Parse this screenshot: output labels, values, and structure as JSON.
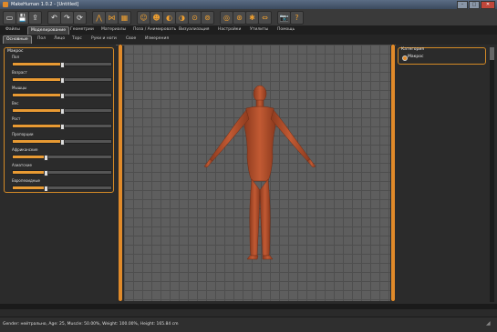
{
  "window": {
    "title": "MakeHuman 1.0.2 - [Untitled]",
    "min": "–",
    "max": "□",
    "close": "✕"
  },
  "toolbar": [
    {
      "name": "undo-save-icon",
      "glyph": "▭"
    },
    {
      "name": "save-icon",
      "glyph": "💾"
    },
    {
      "name": "export-icon",
      "glyph": "⇪"
    },
    {
      "name": "undo-icon",
      "glyph": "↶"
    },
    {
      "name": "redo-icon",
      "glyph": "↷"
    },
    {
      "name": "reset-icon",
      "glyph": "⟳"
    },
    {
      "name": "smooth-icon",
      "glyph": "⋀"
    },
    {
      "name": "wireframe-icon",
      "glyph": "⋈"
    },
    {
      "name": "checker-background-icon",
      "glyph": "▦"
    },
    {
      "name": "front-view-icon",
      "glyph": "☺"
    },
    {
      "name": "back-view-icon",
      "glyph": "☻"
    },
    {
      "name": "left-view-icon",
      "glyph": "◐"
    },
    {
      "name": "right-view-icon",
      "glyph": "◑"
    },
    {
      "name": "top-view-icon",
      "glyph": "⊙"
    },
    {
      "name": "bottom-view-icon",
      "glyph": "⊚"
    },
    {
      "name": "global-camera-icon",
      "glyph": "◎"
    },
    {
      "name": "face-camera-icon",
      "glyph": "⊛"
    },
    {
      "name": "pose-icon",
      "glyph": "✱"
    },
    {
      "name": "symmetry-icon",
      "glyph": "⇔"
    },
    {
      "name": "screenshot-icon",
      "glyph": "📷"
    },
    {
      "name": "help-icon",
      "glyph": "?"
    }
  ],
  "main_tabs": [
    "Файлы",
    "Моделирование",
    "Геометрии",
    "Материалы",
    "Поза / Анимировать",
    "Визуализация",
    "Настройки",
    "Утилиты",
    "Помощь"
  ],
  "main_tab_active": 1,
  "sub_tabs": [
    "Основные",
    "Пол",
    "Лицо",
    "Торс",
    "Руки и ноги",
    "Свое",
    "Измерения"
  ],
  "sub_tab_active": 0,
  "macro": {
    "title": "Макрос",
    "sliders": [
      {
        "label": "Пол",
        "value": 0.5
      },
      {
        "label": "Возраст",
        "value": 0.5
      },
      {
        "label": "Мышцы",
        "value": 0.5
      },
      {
        "label": "Вес",
        "value": 0.5
      },
      {
        "label": "Рост",
        "value": 0.5
      },
      {
        "label": "Пропорции",
        "value": 0.5
      },
      {
        "label": "Африканские",
        "value": 0.33
      },
      {
        "label": "Азиатские",
        "value": 0.33
      },
      {
        "label": "Европеоидные",
        "value": 0.33
      }
    ]
  },
  "category": {
    "title": "Категория",
    "option": "Макрос"
  },
  "status": {
    "text": "Gender: нейтрально, Age: 25, Muscle: 50.00%, Weight: 100.00%, Height: 165.84 cm"
  },
  "colors": {
    "accent": "#e08a2a",
    "skin": "#b4502d",
    "grid": "#5e5e5e"
  }
}
